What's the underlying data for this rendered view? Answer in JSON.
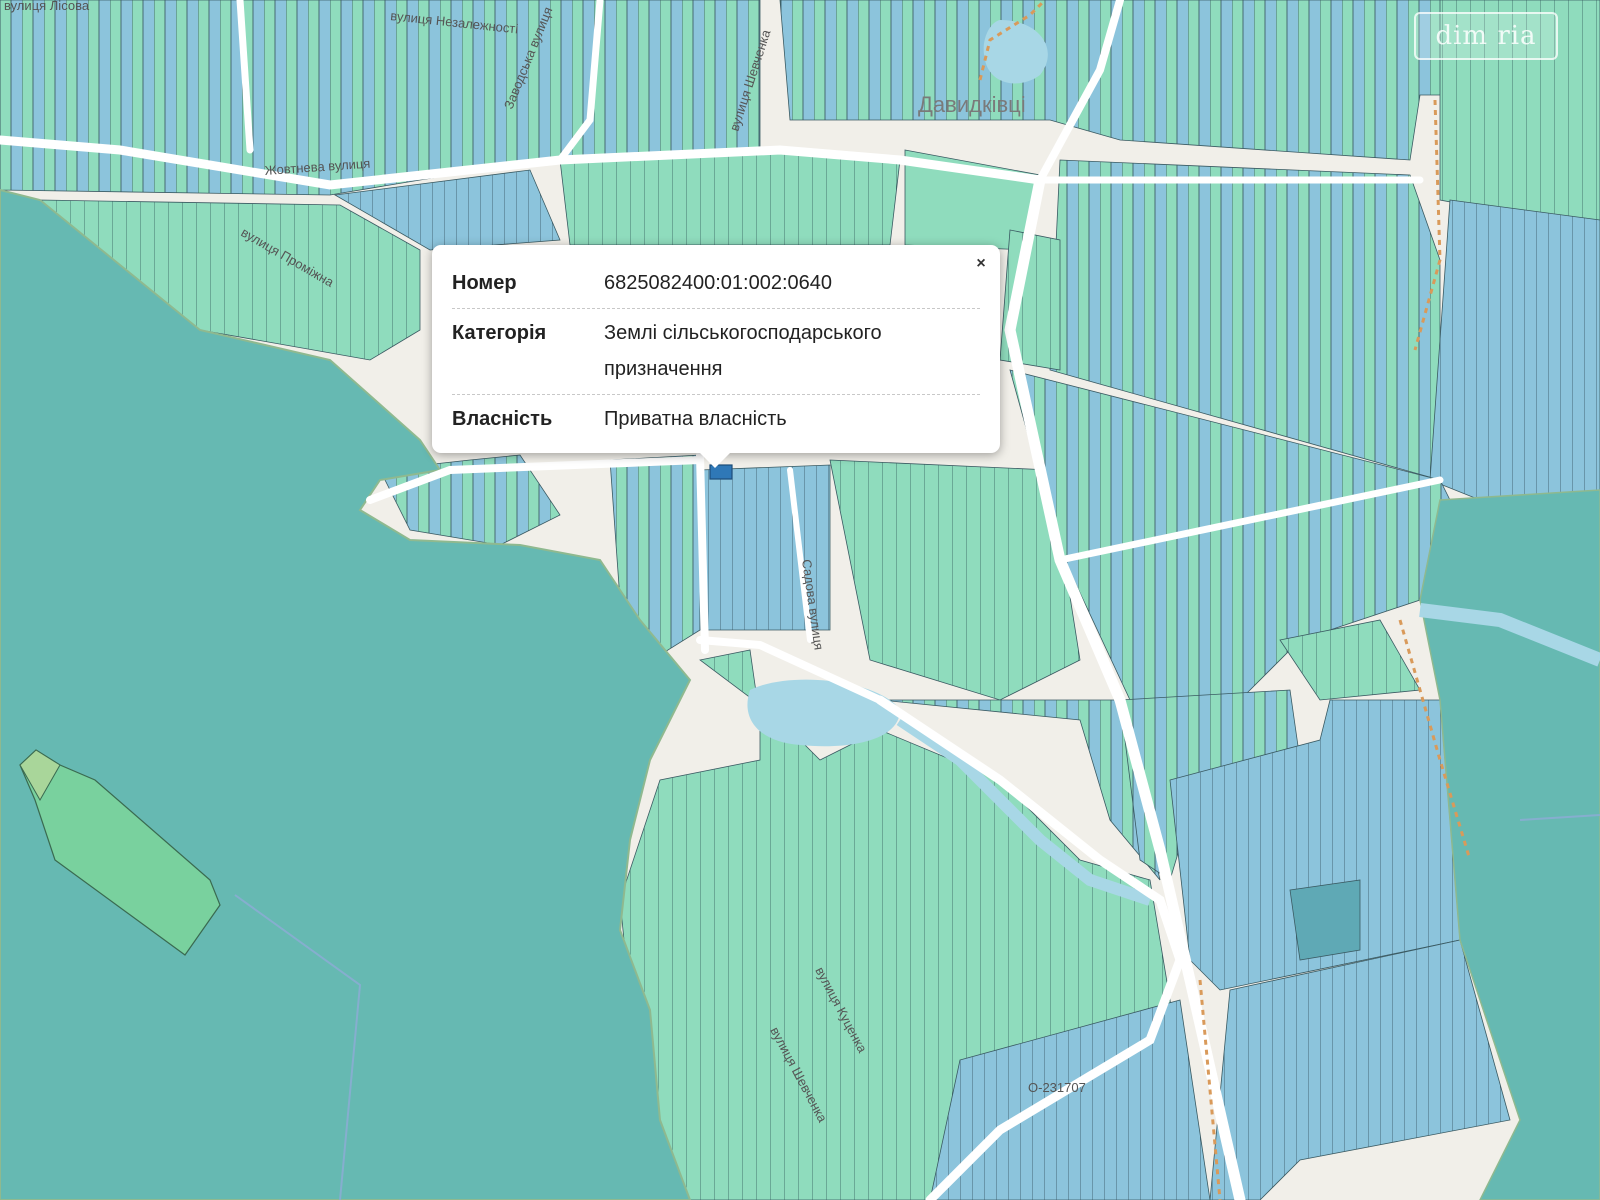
{
  "map": {
    "place_label": "Давидківці",
    "road_number": "О-231707",
    "streets": [
      "вулиця Незалежності",
      "вулиця Шевченка",
      "Жовтнева вулиця",
      "Садова вулиця",
      "вулиця Проміжна",
      "вулиця Лісова",
      "Заводська вулиця",
      "вулиця Куценка",
      "вулиця Шевченка"
    ],
    "colors": {
      "background": "#f1efe9",
      "water_large": "#66b9b2",
      "parcel_green": "#8fdcbd",
      "parcel_blue": "#8cc4dc",
      "parcel_outline": "#3a5a62",
      "road": "#ffffff",
      "pond": "#a8d7e6",
      "selected_parcel": "#2f78b7"
    }
  },
  "popup": {
    "close_symbol": "×",
    "rows": [
      {
        "label": "Номер",
        "value": "6825082400:01:002:0640"
      },
      {
        "label": "Категорія",
        "value": "Землі сільськогосподарського призначення"
      },
      {
        "label": "Власність",
        "value": "Приватна власність"
      }
    ]
  },
  "watermark": {
    "text": "dim ria"
  }
}
